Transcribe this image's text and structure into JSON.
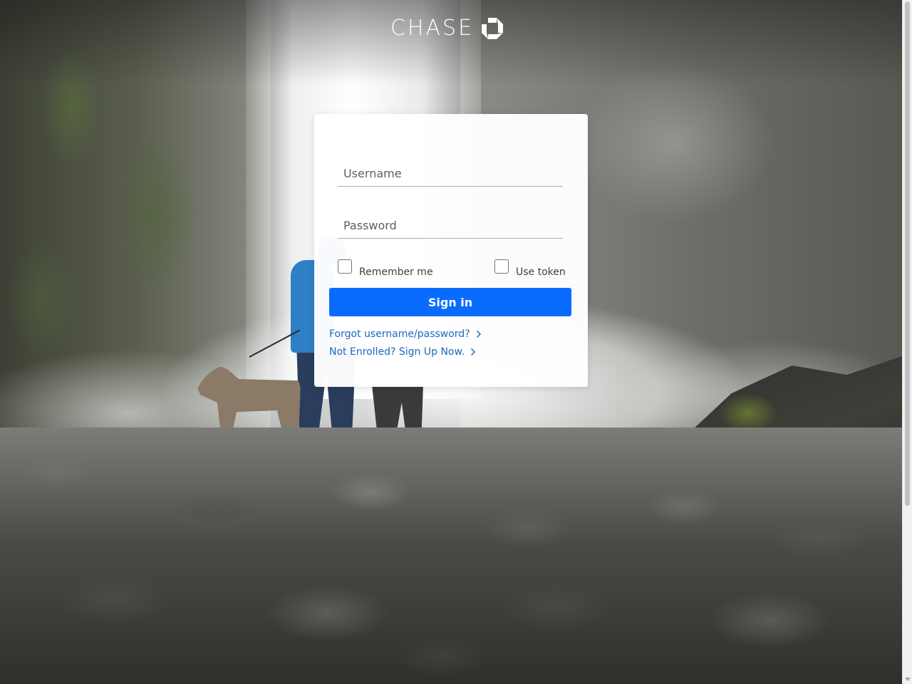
{
  "brand": {
    "name": "CHASE",
    "logo_icon": "chase-octagon-icon"
  },
  "login": {
    "username_placeholder": "Username",
    "password_placeholder": "Password",
    "remember_label": "Remember me",
    "token_label": "Use token",
    "signin_label": "Sign in",
    "forgot_link": "Forgot username/password?",
    "enroll_link": "Not Enrolled? Sign Up Now.",
    "link_icon": "chevron-right-icon"
  },
  "colors": {
    "accent": "#0a6cff",
    "link": "#1a69c0",
    "card": "#ffffff"
  }
}
